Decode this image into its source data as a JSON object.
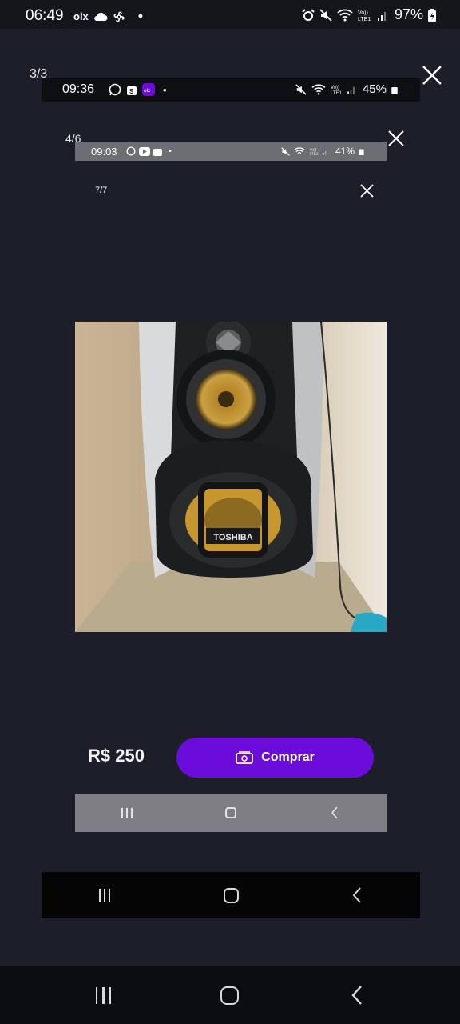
{
  "status_outer": {
    "time": "06:49",
    "olx": "olx",
    "battery": "97%"
  },
  "viewer_level1": {
    "counter": "3/3"
  },
  "status_level2": {
    "time": "09:36",
    "battery": "45%"
  },
  "viewer_level2": {
    "counter": "4/6"
  },
  "status_level3": {
    "time": "09:03",
    "battery": "41%"
  },
  "viewer_level3": {
    "counter": "7/7"
  },
  "product": {
    "brand_on_speaker": "TOSHIBA",
    "price": "R$ 250",
    "buy_label": "Comprar"
  },
  "colors": {
    "background": "#1c1f29",
    "buy_button": "#6c0cdb",
    "speaker_cone": "#c9962f"
  },
  "icons": {
    "close": "close-icon",
    "buy": "cash-icon",
    "nav_recents": "recents-icon",
    "nav_home": "home-icon",
    "nav_back": "back-icon"
  }
}
